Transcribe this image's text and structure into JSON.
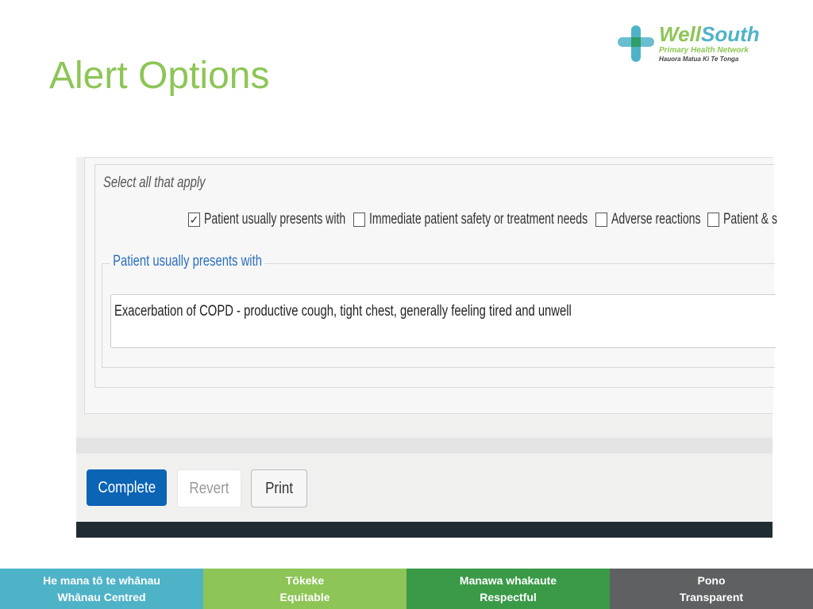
{
  "slide": {
    "title": "Alert Options"
  },
  "logo": {
    "brand_part1": "Well",
    "brand_part2": "South",
    "tagline": "Primary Health Network",
    "maori": "Hauora Matua Ki Te Tonga"
  },
  "form": {
    "instruction": "Select all that apply",
    "options": [
      {
        "label": "Patient usually presents with",
        "checked": true
      },
      {
        "label": "Immediate patient safety or treatment needs",
        "checked": false
      },
      {
        "label": "Adverse reactions",
        "checked": false
      },
      {
        "label": "Patient & s",
        "checked": false
      }
    ],
    "section_legend": "Patient usually presents with",
    "textarea_value": "Exacerbation of COPD - productive cough, tight chest, generally feeling tired and unwell"
  },
  "buttons": {
    "complete": "Complete",
    "revert": "Revert",
    "print": "Print"
  },
  "footer": [
    {
      "line1": "He mana tō te whānau",
      "line2": "Whānau Centred",
      "color": "#4fb3c8"
    },
    {
      "line1": "Tōkeke",
      "line2": "Equitable",
      "color": "#8dc556"
    },
    {
      "line1": "Manawa whakaute",
      "line2": "Respectful",
      "color": "#3a9a48"
    },
    {
      "line1": "Pono",
      "line2": "Transparent",
      "color": "#5f6062"
    }
  ]
}
